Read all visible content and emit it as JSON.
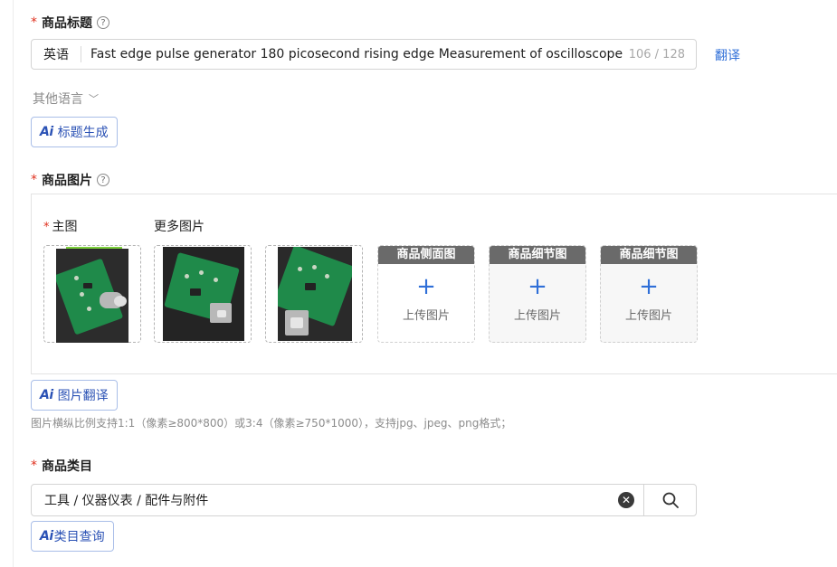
{
  "title_field": {
    "label": "商品标题",
    "help_icon": "?",
    "lang_prefix": "英语",
    "value": "Fast edge pulse generator 180 picosecond rising edge Measurement of oscilloscope ba",
    "counter": "106 / 128",
    "translate_label": "翻译"
  },
  "other_languages": {
    "label": "其他语言",
    "chevron": "﹀"
  },
  "ai_title_button": {
    "ai_mark": "Ai",
    "label": "标题生成"
  },
  "images_field": {
    "label": "商品图片",
    "help_icon": "?",
    "main_label": "主图",
    "more_label": "更多图片",
    "upload_slots": [
      {
        "header": "商品侧面图",
        "plus": "+",
        "text": "上传图片"
      },
      {
        "header": "商品细节图",
        "plus": "+",
        "text": "上传图片"
      },
      {
        "header": "商品细节图",
        "plus": "+",
        "text": "上传图片"
      }
    ]
  },
  "ai_image_button": {
    "ai_mark": "Ai",
    "label": "图片翻译"
  },
  "image_hint": "图片横纵比例支持1:1（像素≥800*800）或3:4（像素≥750*1000），支持jpg、jpeg、png格式；",
  "category_field": {
    "label": "商品类目",
    "value": "工具 / 仪器仪表 / 配件与附件",
    "clear_icon": "✕"
  },
  "ai_category_button": {
    "ai_mark": "Ai",
    "label": "类目查询"
  },
  "colors": {
    "accent": "#2f6fd8",
    "required": "#e0301e",
    "ai_text": "#2b52b5"
  }
}
